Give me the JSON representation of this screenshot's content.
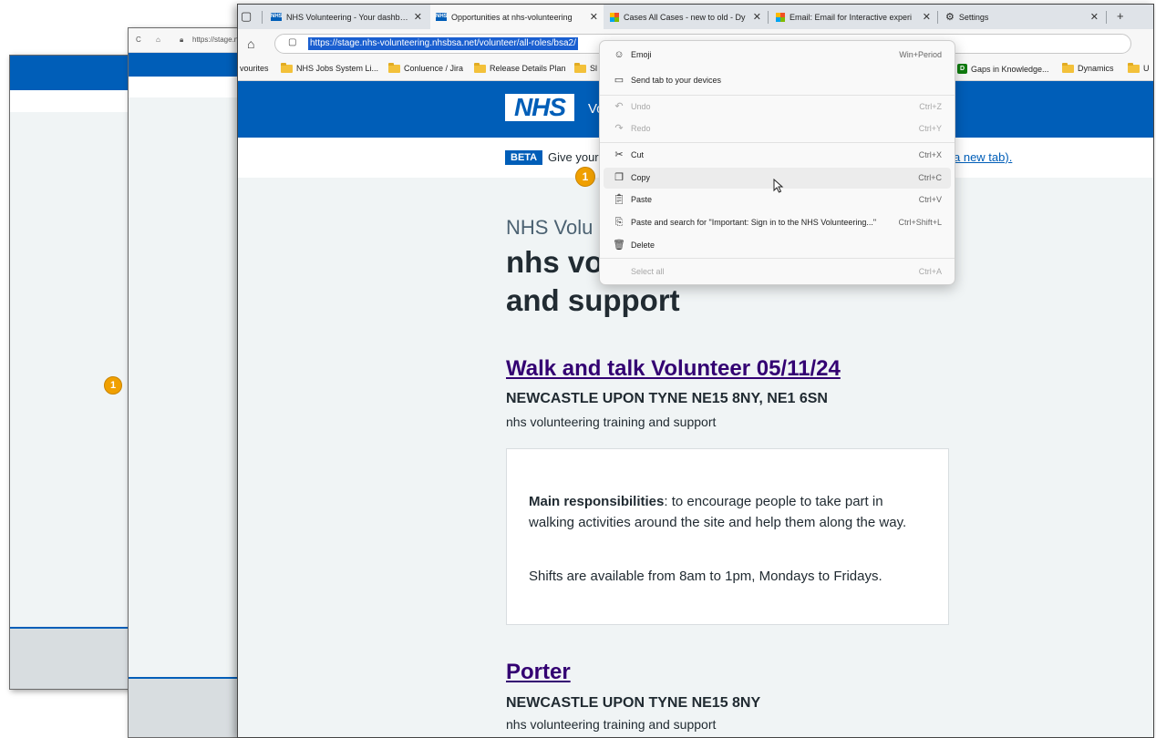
{
  "back_window_b": {
    "url": "https://stage.nh"
  },
  "browser": {
    "tabs": [
      {
        "label": "NHS Volunteering - Your dashboa",
        "icon": "nhs-favicon"
      },
      {
        "label": "Opportunities at nhs-volunteering",
        "icon": "nhs-favicon"
      },
      {
        "label": "Cases All Cases - new to old - Dy",
        "icon": "dynamics-favicon"
      },
      {
        "label": "Email: Email for Interactive experi",
        "icon": "dynamics-favicon"
      },
      {
        "label": "Settings",
        "icon": "gear-icon"
      }
    ],
    "url": "https://stage.nhs-volunteering.nhsbsa.net/volunteer/all-roles/bsa2/",
    "favourites": [
      {
        "label": "vourites"
      },
      {
        "label": "NHS Jobs System Li..."
      },
      {
        "label": "Conluence / Jira"
      },
      {
        "label": "Release Details Plan"
      },
      {
        "label": "Sl"
      },
      {
        "label": "Gaps in Knowledge..."
      },
      {
        "label": "Dynamics"
      },
      {
        "label": "U"
      }
    ]
  },
  "page": {
    "logo": "NHS",
    "service_name": "Vo",
    "beta_tag": "BETA",
    "beta_text": "Give your",
    "beta_link": "a new tab).",
    "marker": "1",
    "org_caption": "NHS Volu",
    "title_line1": "nhs vo",
    "title_line2": "and support",
    "roles": [
      {
        "title": "Walk and talk Volunteer 05/11/24",
        "location": "NEWCASTLE UPON TYNE NE15 8NY, NE1 6SN",
        "org": "nhs volunteering training and support",
        "resp_label": "Main responsibilities",
        "resp_text": ": to encourage people to take part in walking activities around the site and help them along the way.",
        "shifts": "Shifts are available from 8am to 1pm, Mondays to Fridays."
      },
      {
        "title": "Porter",
        "location": "NEWCASTLE UPON TYNE NE15 8NY",
        "org": "nhs volunteering training and support"
      }
    ]
  },
  "context_menu": {
    "items": [
      {
        "label": "Emoji",
        "shortcut": "Win+Period",
        "icon": "emoji-icon"
      },
      {
        "label": "Send tab to your devices",
        "shortcut": "",
        "icon": "send-tab-icon"
      },
      {
        "label": "Undo",
        "shortcut": "Ctrl+Z",
        "icon": "undo-icon",
        "disabled": true
      },
      {
        "label": "Redo",
        "shortcut": "Ctrl+Y",
        "icon": "redo-icon",
        "disabled": true
      },
      {
        "label": "Cut",
        "shortcut": "Ctrl+X",
        "icon": "scissors-icon"
      },
      {
        "label": "Copy",
        "shortcut": "Ctrl+C",
        "icon": "copy-icon"
      },
      {
        "label": "Paste",
        "shortcut": "Ctrl+V",
        "icon": "paste-icon"
      },
      {
        "label": "Paste and search for \"Important: Sign in to the NHS Volunteering...\"",
        "shortcut": "Ctrl+Shift+L",
        "icon": "paste-search-icon"
      },
      {
        "label": "Delete",
        "shortcut": "",
        "icon": "trash-icon"
      },
      {
        "label": "Select all",
        "shortcut": "Ctrl+A",
        "icon": "",
        "disabled": true
      }
    ]
  },
  "colors": {
    "nhs_blue": "#005eb8",
    "link_visited": "#330072",
    "marker": "#f0a000"
  }
}
